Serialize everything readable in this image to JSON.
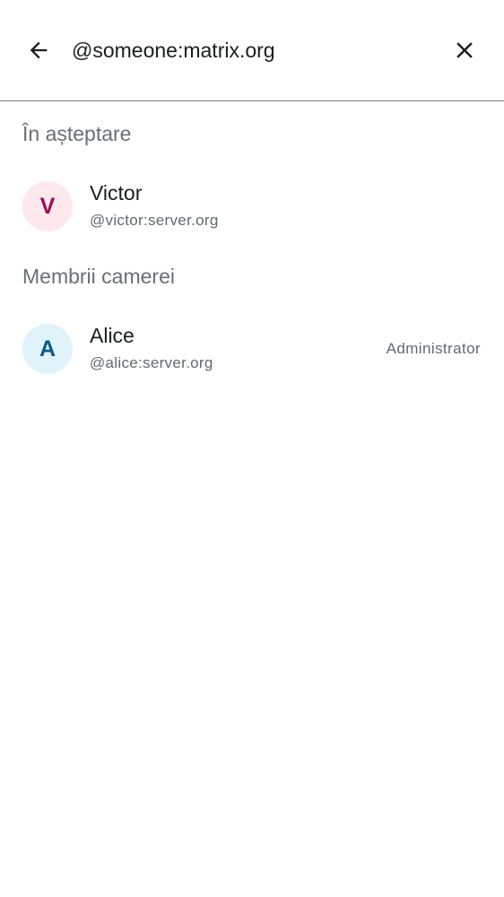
{
  "search": {
    "value": "@someone:matrix.org",
    "back_icon": "arrow-left-icon",
    "clear_icon": "close-icon"
  },
  "sections": {
    "pending": {
      "title": "În așteptare",
      "members": [
        {
          "initial": "V",
          "name": "Victor",
          "user_id": "@victor:server.org",
          "avatar_bg": "#fde8ee",
          "avatar_fg": "#9b0f4a"
        }
      ]
    },
    "room_members": {
      "title": "Membrii camerei",
      "members": [
        {
          "initial": "A",
          "name": "Alice",
          "user_id": "@alice:server.org",
          "role": "Administrator",
          "avatar_bg": "#e1f3fa",
          "avatar_fg": "#0a5a86"
        }
      ]
    }
  },
  "colors": {
    "divider": "#7c7f88",
    "text_primary": "#1b1d22",
    "text_secondary": "#656870"
  }
}
